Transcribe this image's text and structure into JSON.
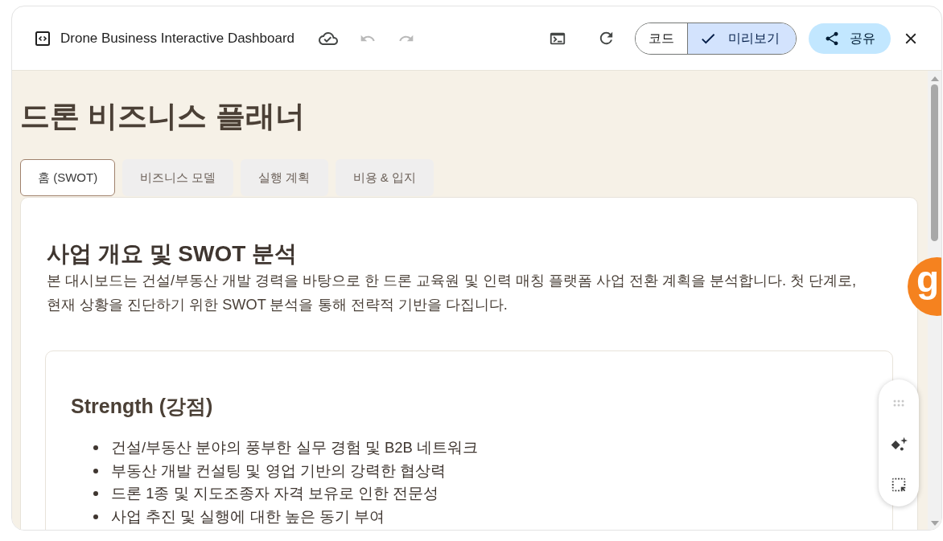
{
  "window": {
    "title": "Drone Business Interactive Dashboard"
  },
  "toolbar": {
    "history": [
      {
        "kind": "undo",
        "disabled": true
      },
      {
        "kind": "redo",
        "disabled": true
      }
    ],
    "view_modes": [
      {
        "label": "코드",
        "selected": false
      },
      {
        "label": "미리보기",
        "selected": true
      }
    ],
    "share_button": "공유"
  },
  "page": {
    "title": "드론 비즈니스 플래너",
    "tabs": [
      {
        "label": "홈 (SWOT)",
        "selected": true
      },
      {
        "label": "비즈니스 모델",
        "selected": false
      },
      {
        "label": "실행 계획",
        "selected": false
      },
      {
        "label": "비용 & 입지",
        "selected": false
      }
    ],
    "section": {
      "heading": "사업 개요 및 SWOT 분석",
      "intro": "본 대시보드는 건설/부동산 개발 경력을 바탕으로 한 드론 교육원 및 인력 매칭 플랫폼 사업 전환 계획을 분석합니다. 첫 단계로, 현재 상황을 진단하기 위한 SWOT 분석을 통해 전략적 기반을 다집니다.",
      "swot_card": {
        "heading": "Strength (강점)",
        "items": [
          "건설/부동산 분야의 풍부한 실무 경험 및 B2B 네트워크",
          "부동산 개발 컨설팅 및 영업 기반의 강력한 협상력",
          "드론 1종 및 지도조종자 자격 보유로 인한 전문성",
          "사업 추진 및 실행에 대한 높은 동기 부여"
        ]
      }
    }
  },
  "floating_badge": {
    "letter": "g"
  }
}
